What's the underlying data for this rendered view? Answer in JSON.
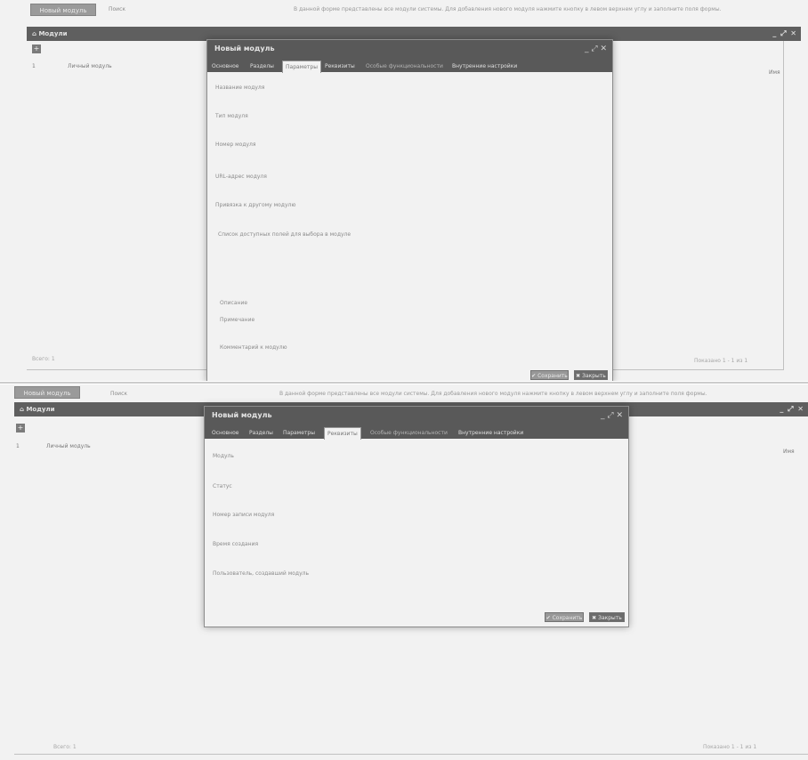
{
  "top": {
    "toolbar_button": "Новый модуль",
    "small_text": "Поиск",
    "info_text": "В данной форме представлены все модули системы. Для добавления нового модуля нажмите кнопку в левом верхнем углу и заполните поля формы."
  },
  "panel": {
    "title": "Модули",
    "controls": "_ ⤢ ✕",
    "add_label": "+",
    "rows": [
      {
        "num": "1",
        "name": "Личный модуль"
      }
    ],
    "right_header": "Имя",
    "footer_left": "Всего: 1",
    "footer_right": "Показано 1 - 1 из 1"
  },
  "modal": {
    "title": "Новый модуль",
    "controls": "_ ⤢ ✕",
    "tabs": [
      "Основное",
      "Разделы",
      "Параметры",
      "Реквизиты",
      "Особые функциональности",
      "Внутренние настройки"
    ],
    "buttons": {
      "save": "✔ Сохранить",
      "close": "✖ Закрыть"
    }
  },
  "shot1": {
    "active_tab_index": 2,
    "fields": [
      "Название модуля",
      "Тип модуля",
      "Номер модуля",
      "URL-адрес модуля",
      "Привязка к другому модулю",
      "Список доступных полей для выбора в модуле",
      "Описание",
      "Примечание",
      "Комментарий к модулю"
    ]
  },
  "shot2": {
    "active_tab_index": 3,
    "fields": [
      "Модуль",
      "Статус",
      "Номер записи модуля",
      "Время создания",
      "Пользователь, создавший модуль"
    ]
  }
}
